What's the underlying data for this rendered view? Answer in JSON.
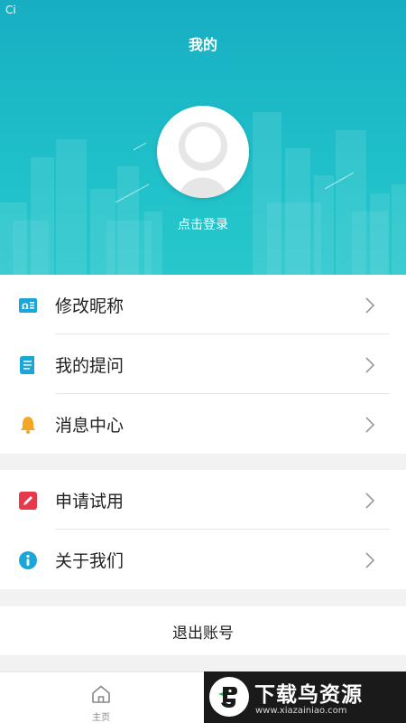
{
  "status_bar": {
    "text": "Ci"
  },
  "header": {
    "title": "我的",
    "login_label": "点击登录"
  },
  "menu_group_1": [
    {
      "label": "修改昵称",
      "icon": "id-card-icon",
      "color": "#1aa6d8"
    },
    {
      "label": "我的提问",
      "icon": "document-icon",
      "color": "#1aa6d8"
    },
    {
      "label": "消息中心",
      "icon": "bell-icon",
      "color": "#f5a623"
    }
  ],
  "menu_group_2": [
    {
      "label": "申请试用",
      "icon": "edit-icon",
      "color": "#e8394a"
    },
    {
      "label": "关于我们",
      "icon": "info-icon",
      "color": "#1aa6d8"
    }
  ],
  "logout_label": "退出账号",
  "tabbar": {
    "home_label": "主页"
  },
  "watermark": {
    "title": "下载鸟资源",
    "url": "www.xiazainiao.com"
  },
  "colors": {
    "header_top": "#17aec3",
    "header_bottom": "#27c7cc",
    "background": "#f2f2f2"
  }
}
